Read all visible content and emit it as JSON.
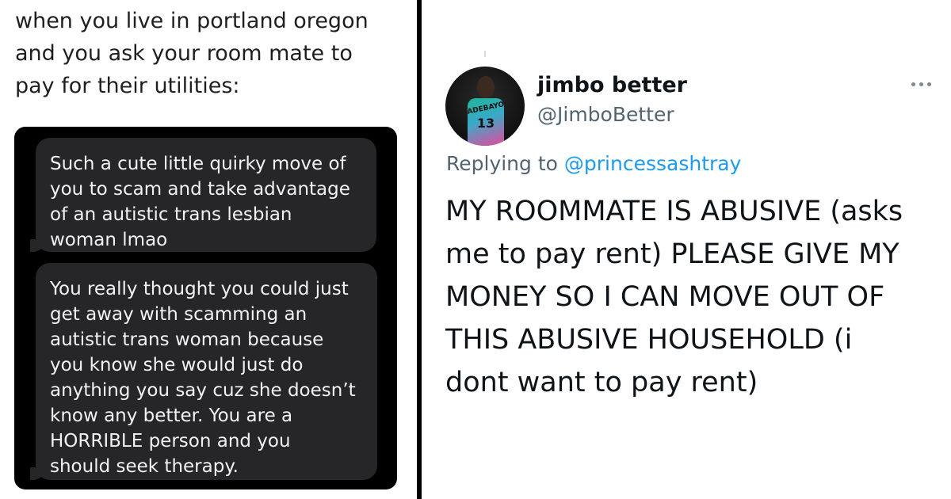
{
  "caption": {
    "lines": [
      "when you live in portland oregon",
      "and you ask your room mate to",
      "pay for their utilities:"
    ]
  },
  "messages": [
    {
      "lines": [
        "Such a cute little quirky move of",
        "you to scam and take advantage",
        "of an autistic trans lesbian",
        "woman lmao"
      ]
    },
    {
      "lines": [
        "You really thought you could just",
        "get away with scamming an",
        "autistic trans woman because",
        "you know she would just do",
        "anything you say cuz she doesn’t",
        "know any better. You are a",
        "HORRIBLE person and you",
        "should seek therapy."
      ]
    }
  ],
  "tweet": {
    "display_name": "jimbo better",
    "handle": "@JimboBetter",
    "avatar": {
      "jersey_name": "ADEBAYO",
      "jersey_number": "13"
    },
    "reply_prefix": "Replying to",
    "reply_mention": "@princessashtray",
    "text_lines": [
      "MY ROOMMATE IS ABUSIVE (asks",
      "me to pay rent) PLEASE GIVE MY",
      "MONEY SO I CAN MOVE OUT OF",
      "THIS ABUSIVE HOUSEHOLD (i",
      "dont want to pay rent)"
    ],
    "more_icon": "more-horizontal-icon"
  },
  "colors": {
    "chat_background": "#000000",
    "bubble": "#262628",
    "mention": "#1d9bf0",
    "secondary_text": "#536471"
  }
}
